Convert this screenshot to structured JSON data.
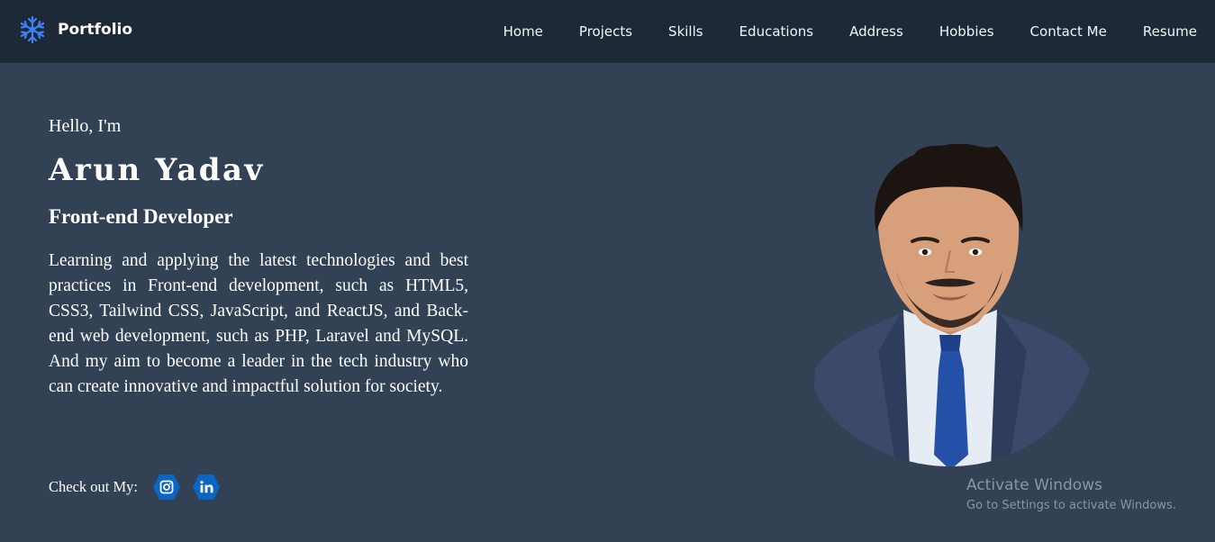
{
  "navbar": {
    "brand": {
      "icon": "snowflake-icon",
      "label": "Portfolio"
    },
    "links": [
      "Home",
      "Projects",
      "Skills",
      "Educations",
      "Address",
      "Hobbies",
      "Contact Me",
      "Resume"
    ]
  },
  "hero": {
    "greeting": "Hello, I'm",
    "name": "Arun Yadav",
    "role": "Front-end Developer",
    "bio": "Learning and applying the latest technologies and best practices in Front-end development, such as HTML5, CSS3, Tailwind CSS, JavaScript, and ReactJS, and Back-end web development, such as PHP, Laravel and MySQL. And my aim to become a leader in the tech industry who can create innovative and impactful solution for society.",
    "social_label": "Check out My:",
    "social": [
      {
        "icon": "instagram-icon"
      },
      {
        "icon": "linkedin-icon"
      }
    ],
    "portrait": "profile-photo"
  },
  "watermark": {
    "title": "Activate Windows",
    "subtitle": "Go to Settings to activate Windows."
  },
  "colors": {
    "page_bg": "#334155",
    "nav_bg": "#1e2937",
    "accent": "#0a66c2",
    "brand_icon": "#3b82f6"
  }
}
